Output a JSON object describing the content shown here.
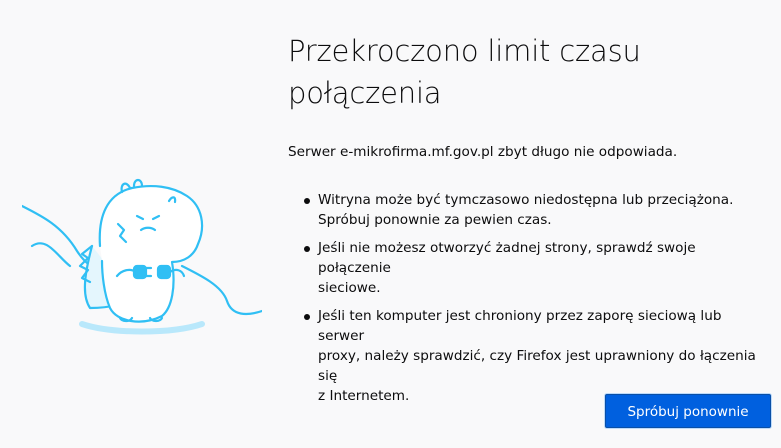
{
  "page": {
    "title_line1": "Przekroczono limit czasu",
    "title_line2": "połączenia",
    "intro": "Serwer e-mikrofirma.mf.gov.pl zbyt długo nie odpowiada.",
    "bullets": [
      {
        "line1": "Witryna może być tymczasowo niedostępna lub przeciążona.",
        "line2": "Spróbuj ponownie za pewien czas."
      },
      {
        "line1": "Jeśli nie możesz otworzyć żadnej strony, sprawdź swoje połączenie",
        "line2": "sieciowe."
      },
      {
        "line1": "Jeśli ten komputer jest chroniony przez zaporę sieciową lub serwer",
        "line2": "proxy, należy sprawdzić, czy Firefox jest uprawniony do łączenia się",
        "line3": "z Internetem."
      }
    ],
    "retry_label": "Spróbuj ponownie"
  },
  "illustration": {
    "icon": "disconnected-plug-creature-icon",
    "color": "#30bff4"
  },
  "colors": {
    "button_bg": "#0060df",
    "background": "#f9f9fa",
    "text": "#0c0c0d"
  }
}
